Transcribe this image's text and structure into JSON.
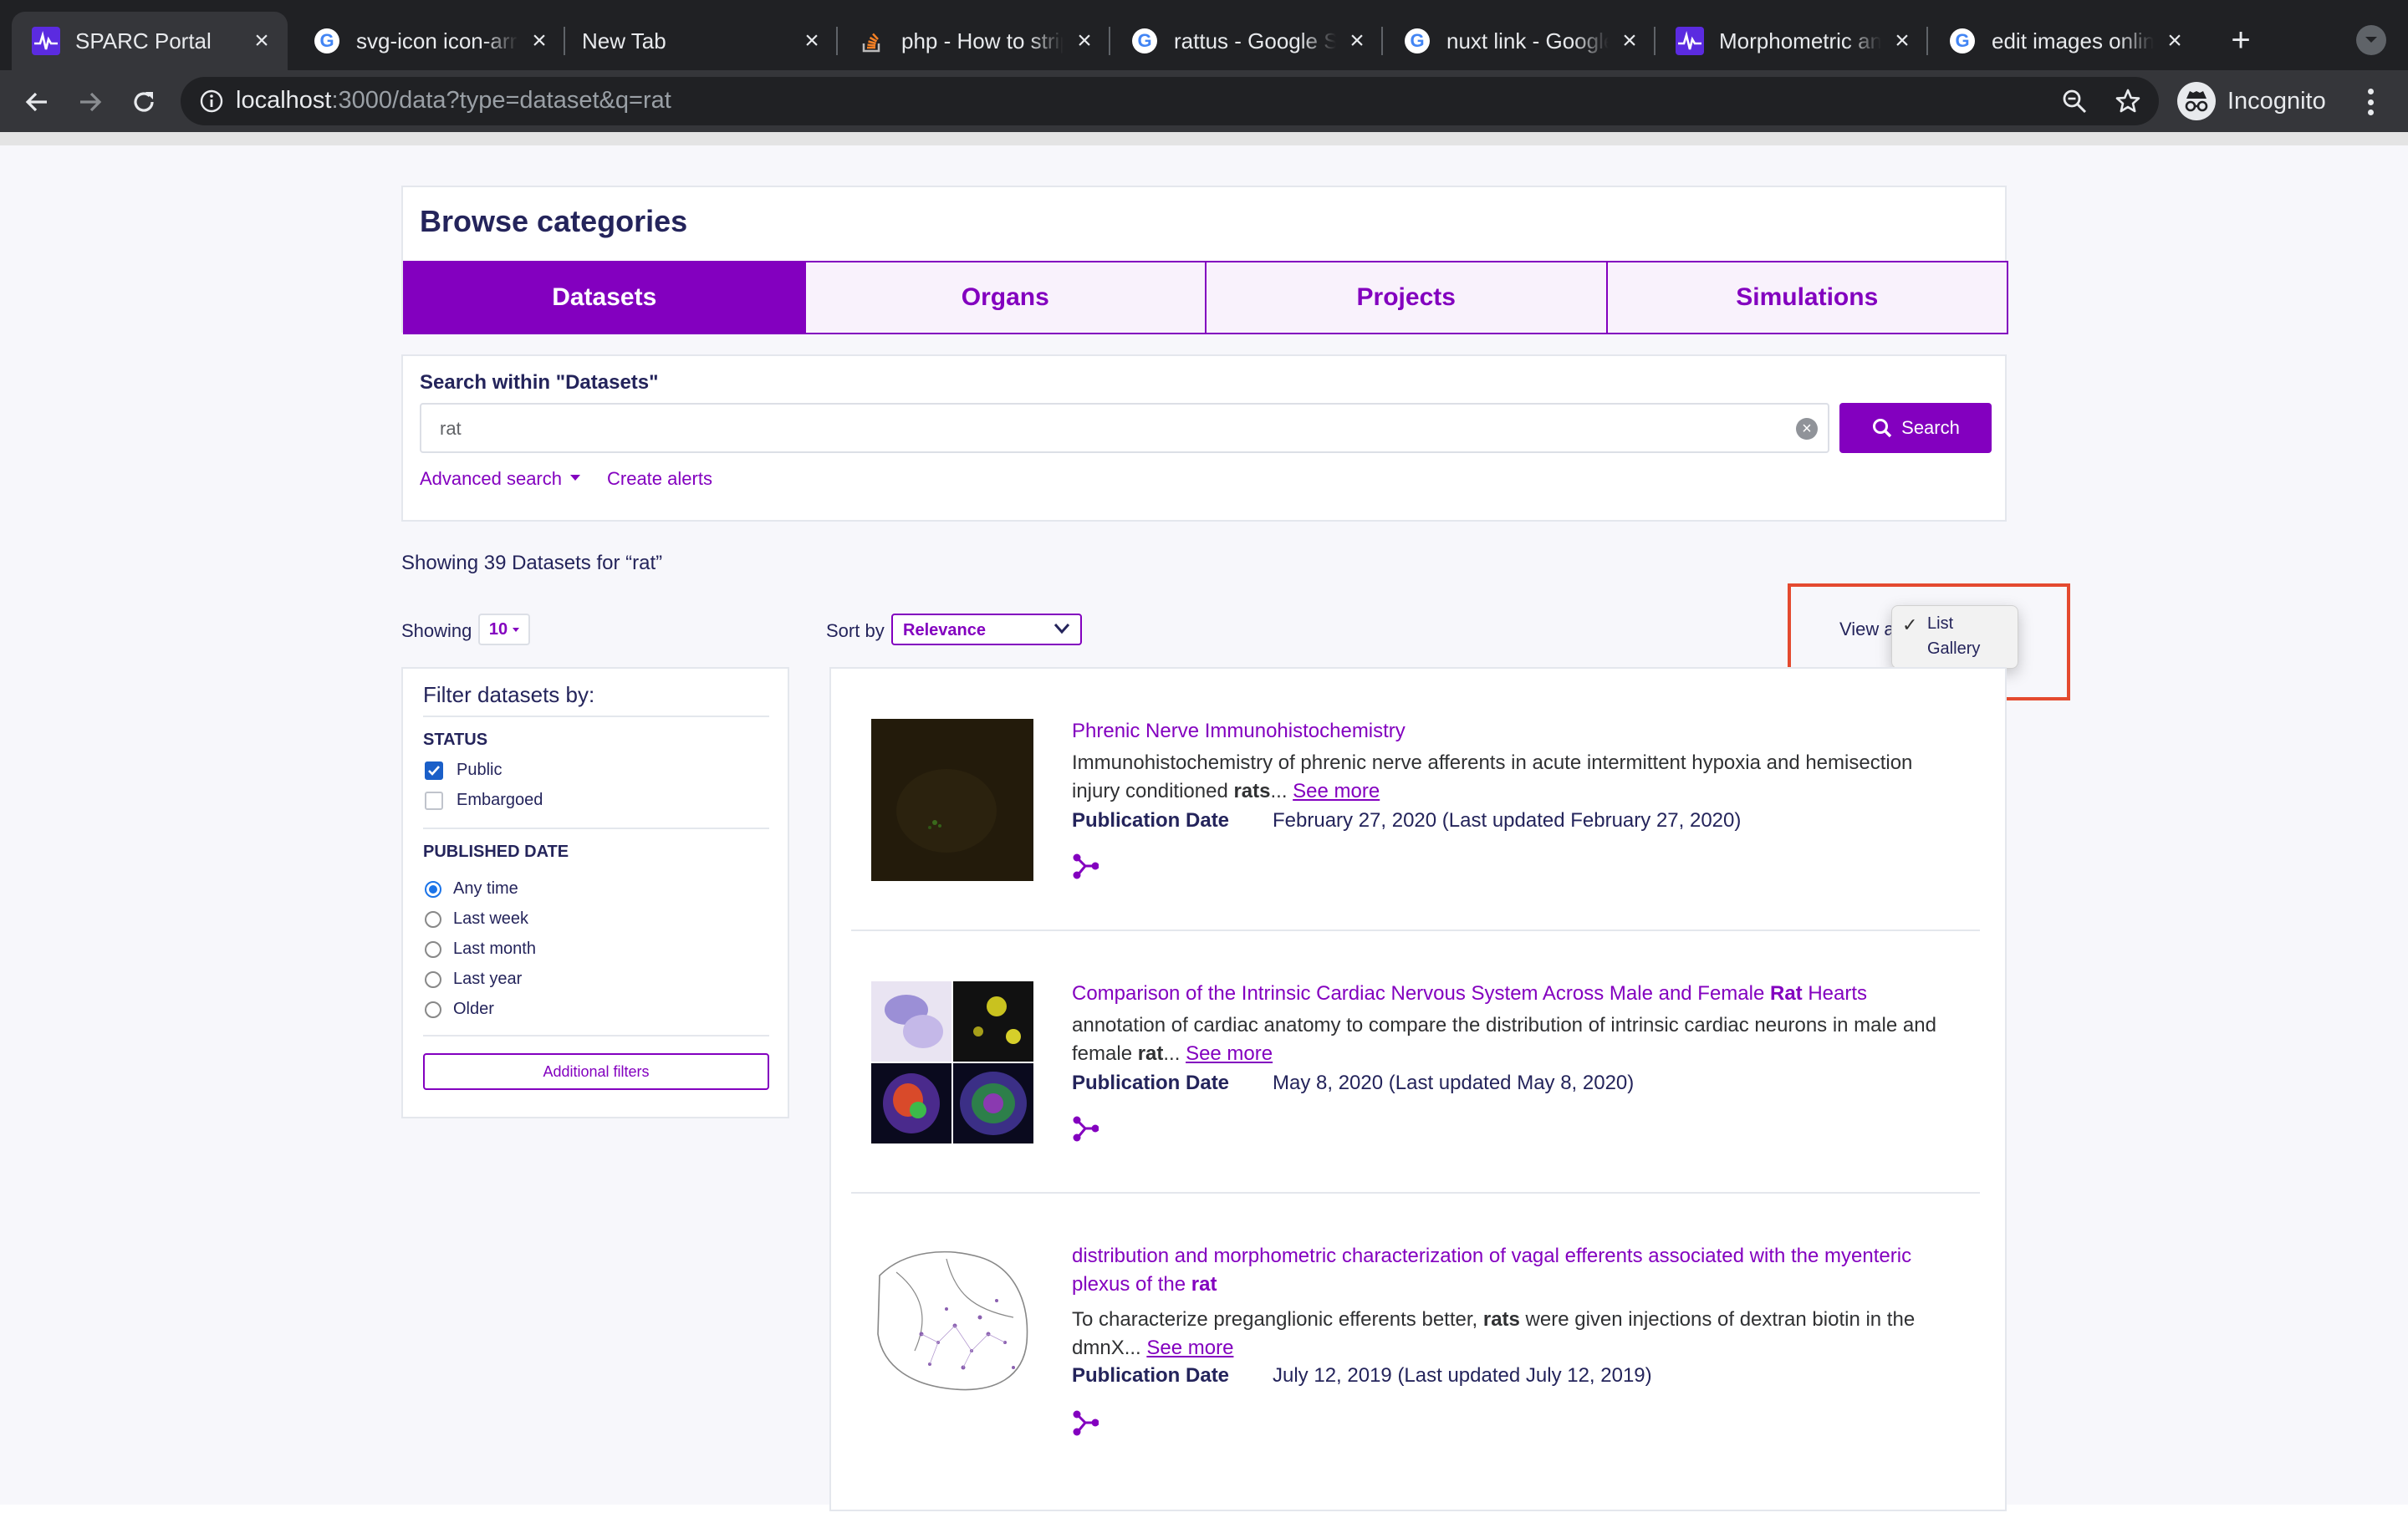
{
  "browser": {
    "tabs": [
      {
        "title": "SPARC Portal",
        "favicon": "sparc-icon",
        "active": true
      },
      {
        "title": "svg-icon icon-arrow",
        "favicon": "google-icon"
      },
      {
        "title": "New Tab",
        "favicon": "none"
      },
      {
        "title": "php - How to strip",
        "favicon": "stackoverflow-icon"
      },
      {
        "title": "rattus - Google Search",
        "favicon": "google-icon"
      },
      {
        "title": "nuxt link - Google Search",
        "favicon": "google-icon"
      },
      {
        "title": "Morphometric and",
        "favicon": "sparc-icon"
      },
      {
        "title": "edit images online",
        "favicon": "google-icon"
      }
    ],
    "url_host": "localhost",
    "url_path": ":3000/data?type=dataset&q=rat",
    "profile_label": "Incognito"
  },
  "browse": {
    "heading": "Browse categories",
    "categories": [
      "Datasets",
      "Organs",
      "Projects",
      "Simulations"
    ],
    "active_category": "Datasets"
  },
  "search": {
    "label": "Search within \"Datasets\"",
    "query": "rat",
    "button": "Search",
    "advanced": "Advanced search",
    "alerts": "Create alerts"
  },
  "results_summary": "Showing 39 Datasets for “rat”",
  "controls": {
    "showing_label": "Showing",
    "page_size": "10",
    "sort_label": "Sort by",
    "sort_value": "Relevance",
    "view_label": "View a",
    "view_options": [
      "List",
      "Gallery"
    ],
    "view_selected": "List"
  },
  "filters": {
    "heading": "Filter datasets by:",
    "status_heading": "STATUS",
    "status_options": [
      {
        "label": "Public",
        "checked": true
      },
      {
        "label": "Embargoed",
        "checked": false
      }
    ],
    "date_heading": "PUBLISHED DATE",
    "date_options": [
      {
        "label": "Any time",
        "selected": true
      },
      {
        "label": "Last week",
        "selected": false
      },
      {
        "label": "Last month",
        "selected": false
      },
      {
        "label": "Last year",
        "selected": false
      },
      {
        "label": "Older",
        "selected": false
      }
    ],
    "more_button": "Additional filters"
  },
  "results": [
    {
      "title_before": "Phrenic Nerve Immunohistochemistry",
      "title_bold": "",
      "title_after": "",
      "desc_before": "Immunohistochemistry of phrenic nerve afferents in acute intermittent hypoxia and hemisection injury conditioned ",
      "desc_bold": "rats",
      "desc_after": "... ",
      "see_more": "See more",
      "pub_label": "Publication Date",
      "pub_value": "February 27, 2020 (Last updated February 27, 2020)"
    },
    {
      "title_before": "Comparison of the Intrinsic Cardiac Nervous System Across Male and Female ",
      "title_bold": "Rat",
      "title_after": " Hearts",
      "desc_before": "annotation of cardiac anatomy to compare the distribution of intrinsic cardiac neurons in male and female ",
      "desc_bold": "rat",
      "desc_after": "... ",
      "see_more": "See more",
      "pub_label": "Publication Date",
      "pub_value": "May 8, 2020 (Last updated May 8, 2020)"
    },
    {
      "title_before": "distribution and morphometric characterization of vagal efferents associated with the myenteric plexus of the ",
      "title_bold": "rat",
      "title_after": "",
      "desc_before": "To characterize preganglionic efferents better, ",
      "desc_bold": "rats",
      "desc_after": " were given injections of dextran biotin in the dmnX... ",
      "see_more": "See more",
      "pub_label": "Publication Date",
      "pub_value": "July 12, 2019 (Last updated July 12, 2019)"
    }
  ],
  "colors": {
    "brand_purple": "#8300bf",
    "highlight_red": "#e44a2f",
    "text_navy": "#24245b"
  }
}
